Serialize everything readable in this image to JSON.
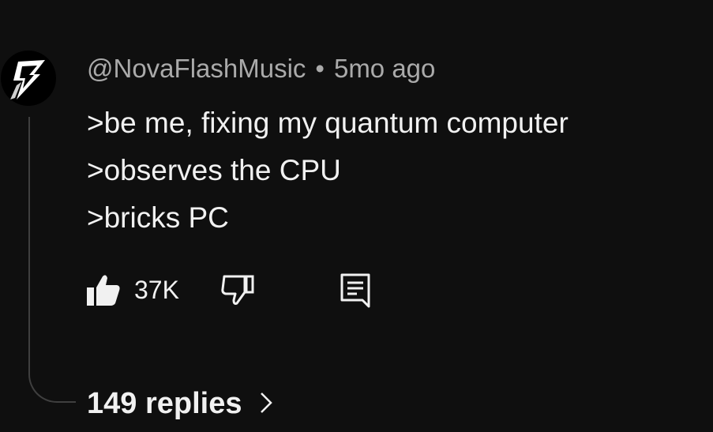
{
  "comment": {
    "author": "@NovaFlashMusic",
    "separator": "•",
    "time": "5mo ago",
    "lines": [
      ">be me, fixing my quantum computer",
      ">observes the CPU",
      ">bricks PC"
    ],
    "likes": "37K",
    "replies_label": "149 replies"
  },
  "icons": {
    "like": "thumbs-up-filled",
    "dislike": "thumbs-down-outline",
    "reply": "comment-reply",
    "expand": "chevron-right",
    "avatar": "lightning-logo"
  },
  "colors": {
    "background": "#0f0f0f",
    "text": "#f1f1f1",
    "secondary_text": "#aaaaaa",
    "thread_line": "#3f3f3f"
  }
}
